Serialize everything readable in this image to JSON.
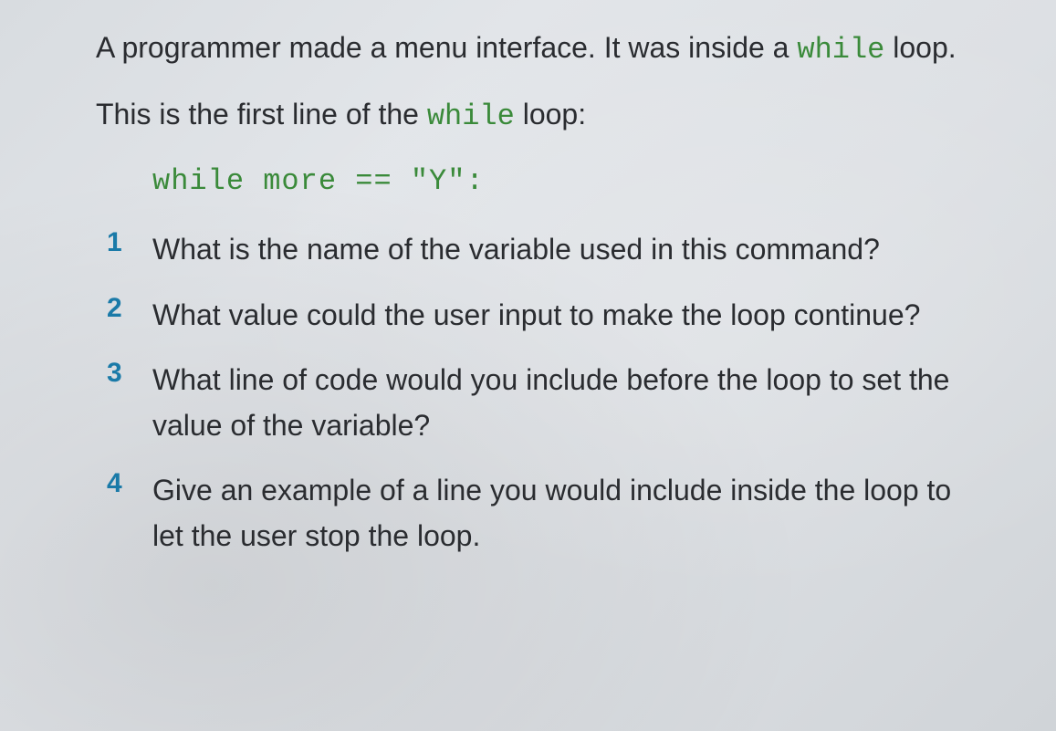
{
  "intro": {
    "part1": "A programmer made a menu interface. It was inside a ",
    "code1": "while",
    "part2": " loop."
  },
  "second_intro": {
    "part1": "This is the first line of the ",
    "code1": "while",
    "part2": " loop:"
  },
  "code_block": "while more == \"Y\":",
  "questions": [
    {
      "number": "1",
      "text": "What is the name of the variable used in this command?"
    },
    {
      "number": "2",
      "text": "What value could the user input to make the loop continue?"
    },
    {
      "number": "3",
      "text": "What line of code would you include before the loop to set the value of the variable?"
    },
    {
      "number": "4",
      "text": "Give an example of a line you would include inside the loop to let the user stop the loop."
    }
  ]
}
